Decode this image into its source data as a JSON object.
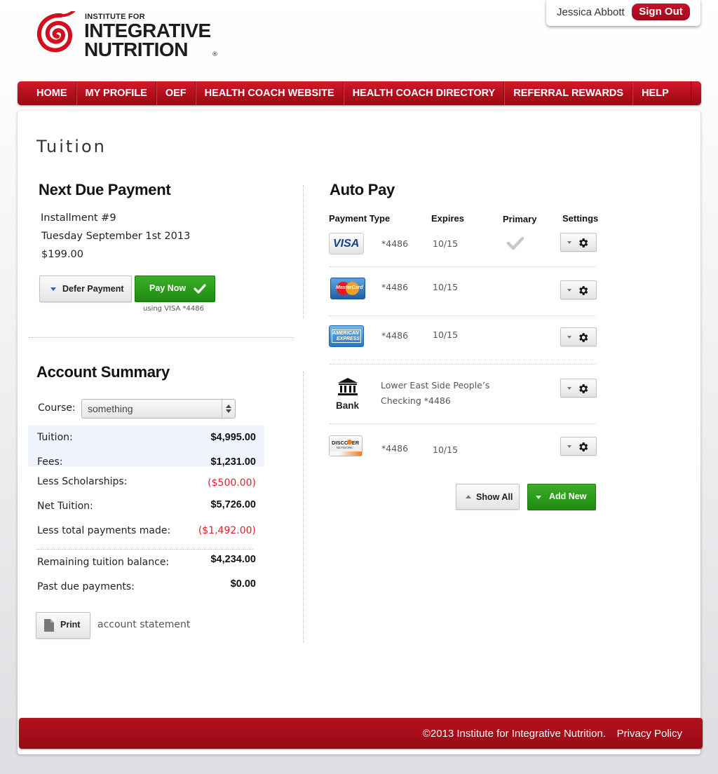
{
  "header": {
    "logo_small": "INSTITUTE FOR",
    "logo_line1": "INTEGRATIVE",
    "logo_line2": "NUTRITION",
    "logo_reg": "®",
    "user_name": "Jessica Abbott",
    "signout_label": "Sign Out"
  },
  "nav": {
    "items": [
      {
        "label": "HOME"
      },
      {
        "label": "MY PROFILE"
      },
      {
        "label": "OEF"
      },
      {
        "label": "HEALTH COACH WEBSITE"
      },
      {
        "label": "HEALTH COACH DIRECTORY"
      },
      {
        "label": "REFERRAL REWARDS"
      },
      {
        "label": "HELP"
      }
    ]
  },
  "page": {
    "title": "Tuition"
  },
  "next_payment": {
    "heading": "Next Due Payment",
    "installment": "Installment #9",
    "date": "Tuesday September 1st  2013",
    "amount": "$199.00",
    "defer_label": "Defer Payment",
    "pay_label": "Pay Now",
    "using": "using VISA *4486"
  },
  "account_summary": {
    "heading": "Account Summary",
    "course_label": "Course:",
    "course_value": "something",
    "rows": [
      {
        "label": "Tuition:",
        "value": "$4,995.00"
      },
      {
        "label": "Fees:",
        "value": "$1,231.00"
      },
      {
        "label": "Less Scholarships:",
        "value": "($500.00)"
      },
      {
        "label": "Net Tuition:",
        "value": "$5,726.00"
      },
      {
        "label": "Less total payments made:",
        "value": "($1,492.00)"
      },
      {
        "label": "Remaining tuition balance:",
        "value": "$4,234.00"
      },
      {
        "label": "Past due payments:",
        "value": "$0.00"
      }
    ],
    "print_label": "Print",
    "print_caption": "account statement"
  },
  "auto_pay": {
    "heading": "Auto Pay",
    "columns": {
      "type": "Payment Type",
      "expires": "Expires",
      "primary": "Primary",
      "settings": "Settings"
    },
    "methods": [
      {
        "brand": "VISA",
        "number": "*4486",
        "expires": "10/15",
        "primary": true
      },
      {
        "brand": "MasterCard",
        "number": "*4486",
        "expires": "10/15",
        "primary": false
      },
      {
        "brand_line1": "AMERICAN",
        "brand_line2": "EXPRESS",
        "number": "*4486",
        "expires": "10/15",
        "primary": false
      },
      {
        "brand": "Bank",
        "line1": "Lower East Side People’s",
        "line2": "Checking *4486",
        "primary": false
      },
      {
        "brand": "DISCOVER",
        "brand_sub": "NETWORK",
        "number": "*4486",
        "expires": "10/15",
        "primary": false
      }
    ],
    "show_all_label": "Show All",
    "add_new_label": "Add New"
  },
  "footer": {
    "copyright": "©2013 Institute for Integrative Nutrition.",
    "privacy": "Privacy Policy"
  },
  "colors": {
    "brand_red": "#b50f1d",
    "green": "#2a9c1a",
    "negative": "#e0202a"
  },
  "icons": [
    "spiral-logo-icon",
    "checkmark-icon",
    "gear-icon",
    "bank-icon",
    "document-icon",
    "caret-down-icon",
    "caret-up-icon"
  ]
}
